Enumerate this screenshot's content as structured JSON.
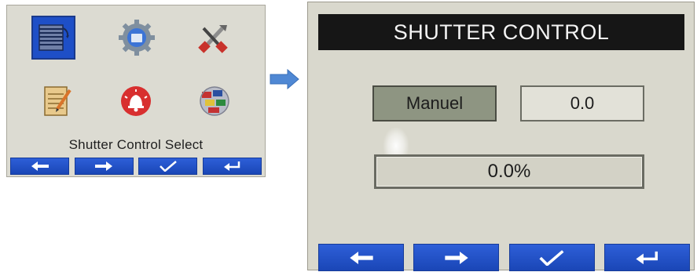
{
  "left_screen": {
    "caption": "Shutter Control Select",
    "menu_icons": [
      {
        "name": "shutter-control-icon",
        "selected": true
      },
      {
        "name": "settings-gear-icon",
        "selected": false
      },
      {
        "name": "tools-icon",
        "selected": false
      },
      {
        "name": "notepad-icon",
        "selected": false
      },
      {
        "name": "alarm-icon",
        "selected": false
      },
      {
        "name": "globe-language-icon",
        "selected": false
      }
    ],
    "nav_buttons": [
      {
        "name": "prev-button",
        "icon": "arrow-left-icon"
      },
      {
        "name": "next-button",
        "icon": "arrow-right-icon"
      },
      {
        "name": "confirm-button",
        "icon": "checkmark-icon"
      },
      {
        "name": "back-button",
        "icon": "return-icon"
      }
    ]
  },
  "right_screen": {
    "title": "SHUTTER CONTROL",
    "mode_label": "Manuel",
    "value": "0.0",
    "progress_text": "0.0%",
    "progress_fraction": 0.0,
    "nav_buttons": [
      {
        "name": "prev-button",
        "icon": "arrow-left-icon"
      },
      {
        "name": "next-button",
        "icon": "arrow-right-icon"
      },
      {
        "name": "confirm-button",
        "icon": "checkmark-icon"
      },
      {
        "name": "back-button",
        "icon": "return-icon"
      }
    ]
  },
  "colors": {
    "nav_blue": "#1e4fc7",
    "screen_bg": "#d9d8cd",
    "title_bg": "#161616",
    "mode_button_bg": "#8e9582",
    "transition_arrow": "#4f88d4"
  }
}
